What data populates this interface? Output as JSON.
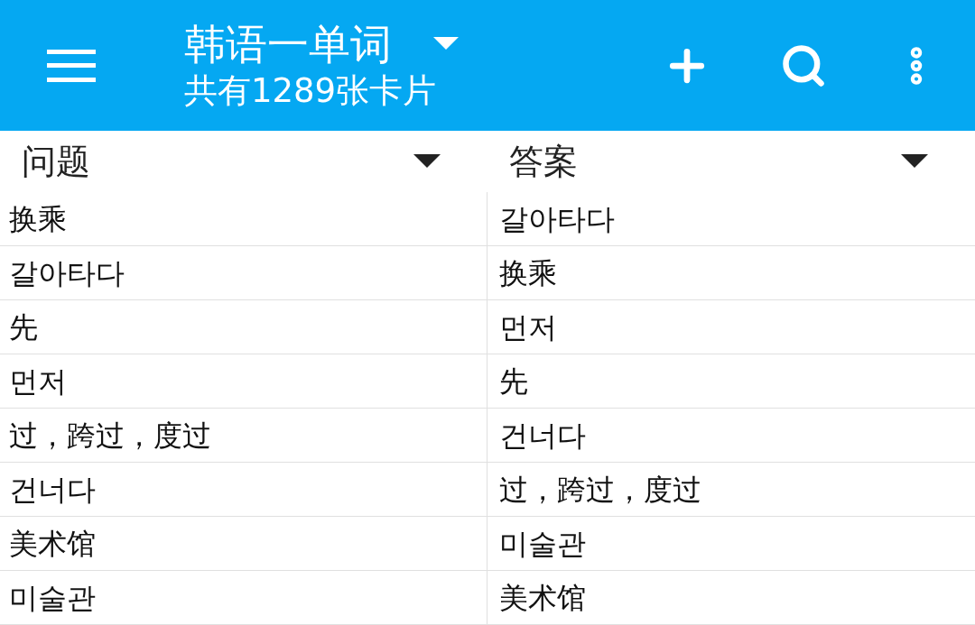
{
  "toolbar": {
    "title": "韩语一单词",
    "subtitle": "共有1289张卡片"
  },
  "table": {
    "columns": [
      "问题",
      "答案"
    ],
    "rows": [
      [
        "换乘",
        "갈아타다"
      ],
      [
        "갈아타다",
        "换乘"
      ],
      [
        "先",
        "먼저"
      ],
      [
        "먼저",
        "先"
      ],
      [
        "过，跨过，度过",
        "건너다"
      ],
      [
        "건너다",
        "过，跨过，度过"
      ],
      [
        "美术馆",
        "미술관"
      ],
      [
        "미술관",
        "美术馆"
      ]
    ]
  }
}
